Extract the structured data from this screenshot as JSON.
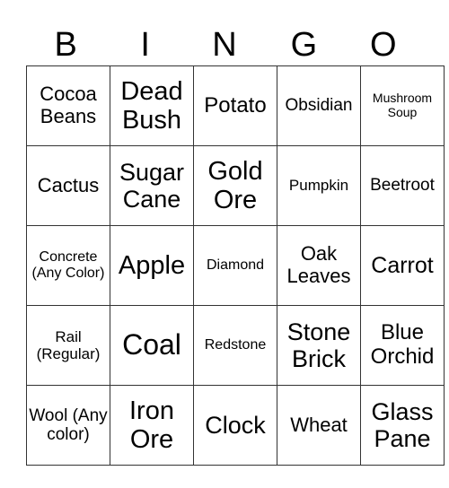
{
  "header": [
    "B",
    "I",
    "N",
    "G",
    "O"
  ],
  "rows": [
    [
      "Cocoa Beans",
      "Dead Bush",
      "Potato",
      "Obsidian",
      "Mushroom Soup"
    ],
    [
      "Cactus",
      "Sugar Cane",
      "Gold Ore",
      "Pumpkin",
      "Beetroot"
    ],
    [
      "Concrete (Any Color)",
      "Apple",
      "Diamond",
      "Oak Leaves",
      "Carrot"
    ],
    [
      "Rail (Regular)",
      "Coal",
      "Redstone",
      "Stone Brick",
      "Blue Orchid"
    ],
    [
      "Wool (Any color)",
      "Iron Ore",
      "Clock",
      "Wheat",
      "Glass Pane"
    ]
  ]
}
